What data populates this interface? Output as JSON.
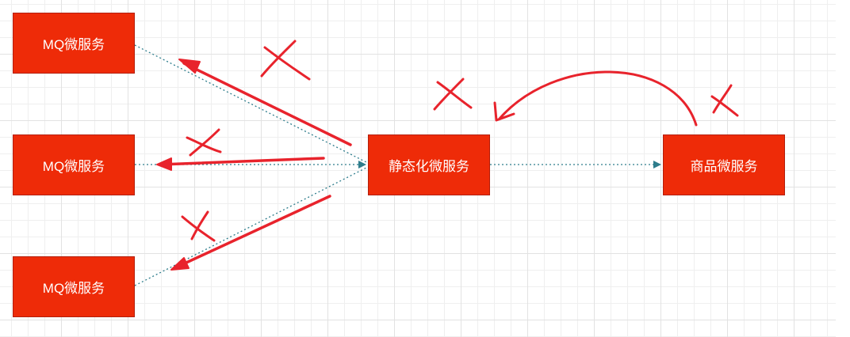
{
  "nodes": {
    "mq_service_1": "MQ微服务",
    "mq_service_2": "MQ微服务",
    "mq_service_3": "MQ微服务",
    "static_service": "静态化微服务",
    "product_service": "商品微服务"
  },
  "colors": {
    "node_fill": "#ee2b08",
    "node_text": "#ffffff",
    "connector": "#2e7d8c",
    "annotation": "#e8232c"
  },
  "annotation_marks": [
    "cross",
    "cross",
    "cross",
    "cross",
    "cross"
  ]
}
